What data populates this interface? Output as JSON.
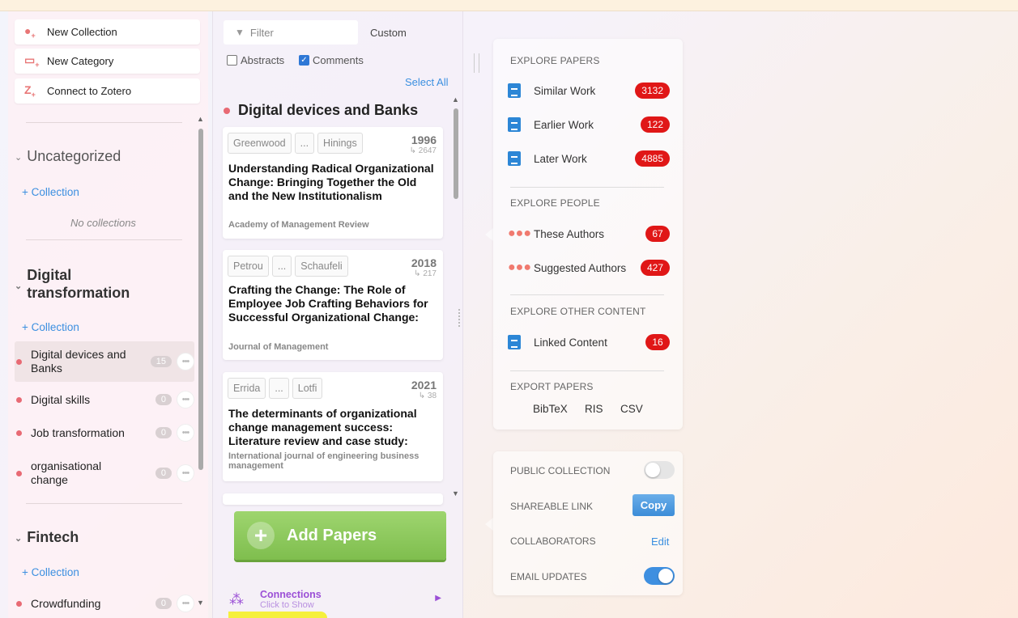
{
  "sidebar": {
    "buttons": [
      {
        "label": "New Collection",
        "icon": "new-collection-icon"
      },
      {
        "label": "New Category",
        "icon": "new-category-icon"
      },
      {
        "label": "Connect to Zotero",
        "icon": "zotero-icon"
      }
    ],
    "categories": [
      {
        "name": "Uncategorized",
        "add_label": "+ Collection",
        "empty_label": "No collections"
      },
      {
        "name": "Digital transformation",
        "add_label": "+ Collection"
      },
      {
        "name": "Fintech",
        "add_label": "+ Collection"
      }
    ],
    "collections": [
      {
        "label": "Digital devices and Banks",
        "count": "15"
      },
      {
        "label": "Digital skills",
        "count": "0"
      },
      {
        "label": "Job transformation",
        "count": "0"
      },
      {
        "label": "organisational change",
        "count": "0"
      },
      {
        "label": "Crowdfunding",
        "count": "0"
      }
    ]
  },
  "middle": {
    "filter_placeholder": "Filter",
    "sort_label": "Custom",
    "abstracts_label": "Abstracts",
    "comments_label": "Comments",
    "abstracts_checked": false,
    "comments_checked": true,
    "select_all": "Select All",
    "collection_title": "Digital devices and Banks",
    "papers": [
      {
        "author1": "Greenwood",
        "ellipsis": "...",
        "author2": "Hinings",
        "year": "1996",
        "cites": "↳ 2647",
        "title": "Understanding Radical Organizational Change: Bringing Together the Old and the New Institutionalism",
        "journal": "Academy of Management Review"
      },
      {
        "author1": "Petrou",
        "ellipsis": "...",
        "author2": "Schaufeli",
        "year": "2018",
        "cites": "↳ 217",
        "title": "Crafting the Change: The Role of Employee Job Crafting Behaviors for Successful Organizational Change:",
        "journal": "Journal of Management"
      },
      {
        "author1": "Errida",
        "ellipsis": "...",
        "author2": "Lotfi",
        "year": "2021",
        "cites": "↳ 38",
        "title": "The determinants of organizational change management success: Literature review and case study:",
        "journal": "International journal of engineering business management"
      }
    ],
    "add_papers": "Add Papers",
    "connections_title": "Connections",
    "connections_sub": "Click to Show"
  },
  "explore": {
    "papers_head": "EXPLORE PAPERS",
    "similar": {
      "label": "Similar Work",
      "count": "3132"
    },
    "earlier": {
      "label": "Earlier Work",
      "count": "122"
    },
    "later": {
      "label": "Later Work",
      "count": "4885"
    },
    "people_head": "EXPLORE PEOPLE",
    "these_authors": {
      "label": "These Authors",
      "count": "67"
    },
    "suggested_authors": {
      "label": "Suggested Authors",
      "count": "427"
    },
    "other_head": "EXPLORE OTHER CONTENT",
    "linked": {
      "label": "Linked Content",
      "count": "16"
    },
    "export_head": "EXPORT PAPERS",
    "export_formats": [
      "BibTeX",
      "RIS",
      "CSV"
    ]
  },
  "settings": {
    "public_label": "PUBLIC COLLECTION",
    "public_on": false,
    "link_label": "SHAREABLE LINK",
    "copy_label": "Copy",
    "collab_label": "COLLABORATORS",
    "edit_label": "Edit",
    "email_label": "EMAIL UPDATES",
    "email_on": true
  },
  "colors": {
    "accent_blue": "#3b8fe0",
    "badge_red": "#e01717",
    "add_green": "#8cc95d",
    "collection_dot": "#e86a74",
    "connections_purple": "#9b4fd6"
  }
}
